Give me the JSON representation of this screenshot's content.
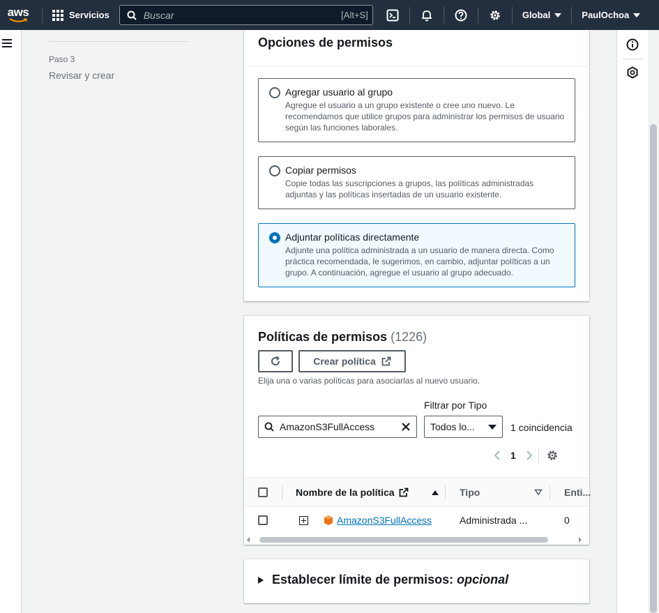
{
  "nav": {
    "logo": "aws",
    "services_label": "Servicios",
    "search_placeholder": "Buscar",
    "search_shortcut": "[Alt+S]",
    "region_label": "Global",
    "user_label": "PaulOchoa"
  },
  "steps": {
    "step_number": "Paso 3",
    "step_label": "Revisar y crear"
  },
  "permission_options": {
    "title": "Opciones de permisos",
    "options": [
      {
        "title": "Agregar usuario al grupo",
        "description": "Agregue el usuario a un grupo existente o cree uno nuevo. Le recomendamos que utilice grupos para administrar los permisos de usuario según las funciones laborales.",
        "selected": false
      },
      {
        "title": "Copiar permisos",
        "description": "Copie todas las suscripciones a grupos, las políticas administradas adjuntas y las políticas insertadas de un usuario existente.",
        "selected": false
      },
      {
        "title": "Adjuntar políticas directamente",
        "description": "Adjunte una política administrada a un usuario de manera directa. Como práctica recomendada, le sugerimos, en cambio, adjuntar políticas a un grupo. A continuación, agregue el usuario al grupo adecuado.",
        "selected": true
      }
    ]
  },
  "policies": {
    "title": "Políticas de permisos",
    "count": "(1226)",
    "create_label": "Crear política",
    "description": "Elija una o varias políticas para asociarlas al nuevo usuario.",
    "filter_type_label": "Filtrar por Tipo",
    "search_value": "AmazonS3FullAccess",
    "type_value": "Todos lo...",
    "matches": "1 coincidencia",
    "page": "1",
    "columns": [
      "Nombre de la política",
      "Tipo",
      "Enti..."
    ],
    "rows": [
      {
        "name": "AmazonS3FullAccess",
        "type": "Administrada ...",
        "entities": "0"
      }
    ]
  },
  "boundary": {
    "title": "Establecer límite de permisos:",
    "title_italic": "opcional"
  },
  "colors": {
    "nav_bg": "#232f3e",
    "accent": "#0073bb",
    "s3_icon": "#ec7211"
  }
}
